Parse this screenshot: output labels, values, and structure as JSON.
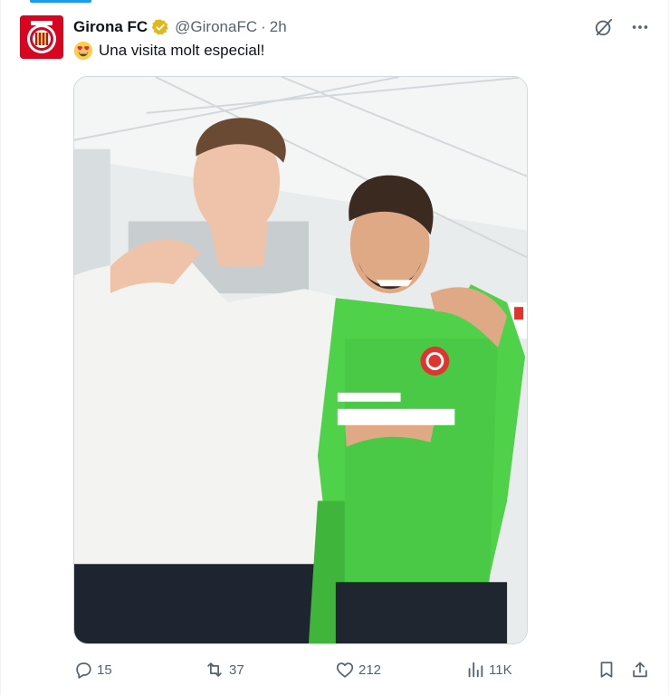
{
  "author": {
    "display_name": "Girona FC",
    "handle": "@GironaFC",
    "separator": "·",
    "time": "2h",
    "avatar_icon": "girona-crest-icon",
    "verified_icon": "verified-gold-badge-icon"
  },
  "post": {
    "emoji_icon": "heart-eyes-emoji-icon",
    "text": "Una visita molt especial!"
  },
  "header_actions": {
    "grok_icon": "grok-icon",
    "more_icon": "more-icon"
  },
  "media": {
    "type": "photo",
    "description_icon": "tweet-photo"
  },
  "stats": {
    "replies": "15",
    "reposts": "37",
    "likes": "212",
    "views": "11K"
  },
  "colors": {
    "accent": "#1d9bf0",
    "text": "#0f1419",
    "muted": "#536471",
    "girona_red": "#d9041f",
    "verified_gold": "#e2b719",
    "jersey_green": "#4fd14a"
  }
}
